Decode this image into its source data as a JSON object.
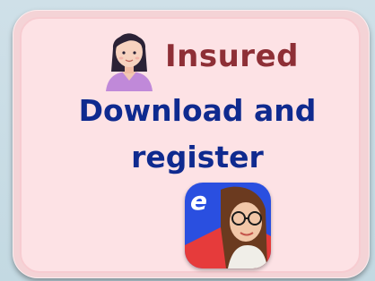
{
  "card": {
    "role_label": "Insured",
    "instruction": "Download and register",
    "role_icon": "woman-avatar-icon",
    "app_icon": "app-logo-icon",
    "app_letter": "e"
  },
  "colors": {
    "background": "#c9dde5",
    "card": "#fde2e5",
    "role_text": "#8e2f36",
    "instruction_text": "#0f2a8f",
    "app_blue": "#2a4fe0",
    "app_red": "#e63b3b"
  }
}
